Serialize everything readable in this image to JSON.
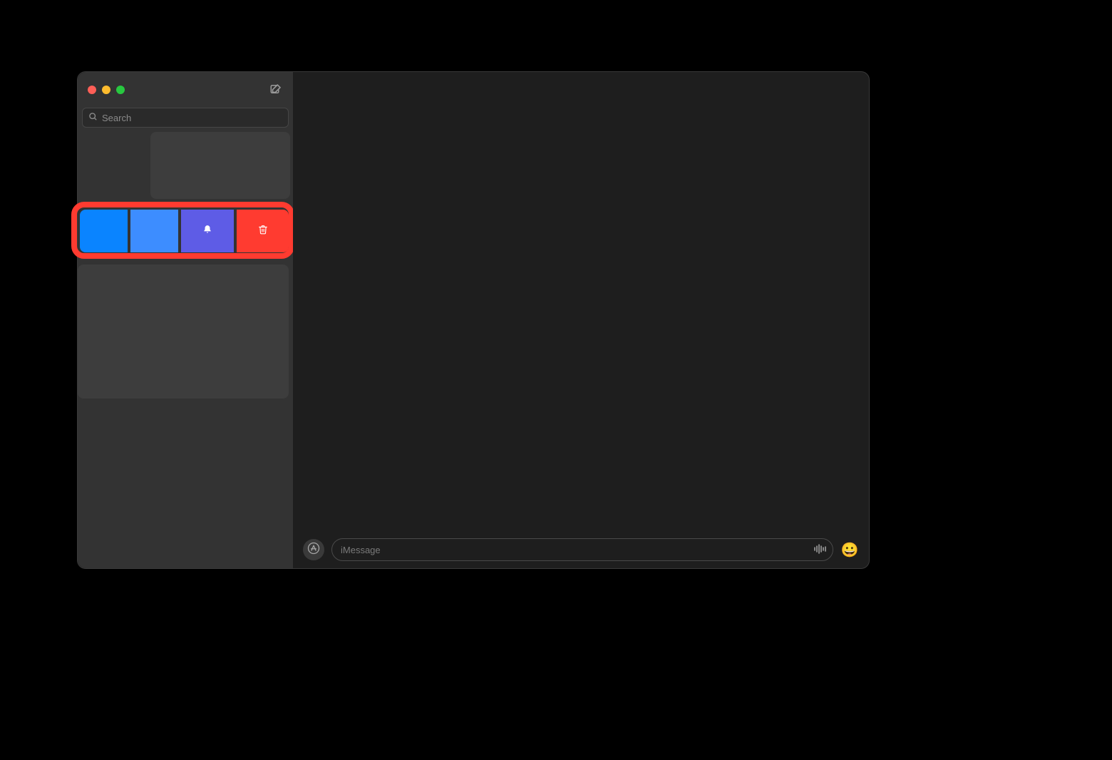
{
  "sidebar": {
    "search_placeholder": "Search",
    "swipe_actions": {
      "hide_label": "",
      "pin_label": "",
      "mute_label": "",
      "delete_label": ""
    }
  },
  "composer": {
    "placeholder": "iMessage"
  },
  "colors": {
    "swipe_blue": "#0a84ff",
    "swipe_blue_light": "#3d8dff",
    "swipe_purple": "#5e5ce6",
    "swipe_red": "#ff3b30",
    "highlight": "#ff3b30"
  }
}
